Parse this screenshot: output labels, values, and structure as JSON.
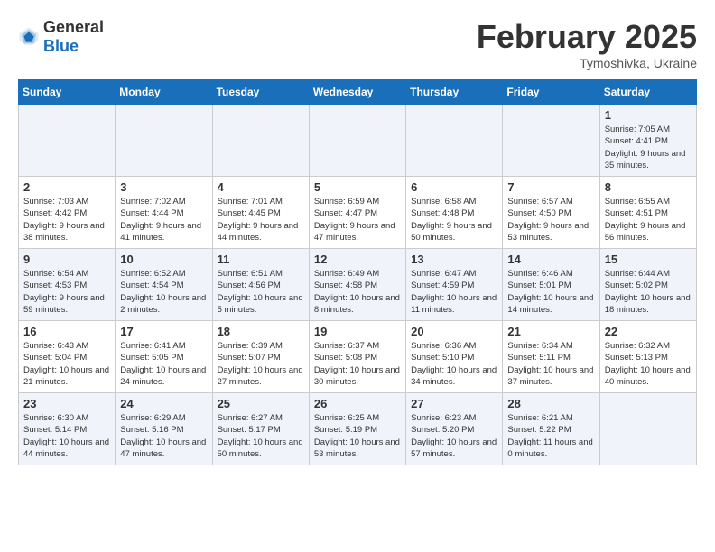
{
  "header": {
    "logo_general": "General",
    "logo_blue": "Blue",
    "title": "February 2025",
    "subtitle": "Tymoshivka, Ukraine"
  },
  "weekdays": [
    "Sunday",
    "Monday",
    "Tuesday",
    "Wednesday",
    "Thursday",
    "Friday",
    "Saturday"
  ],
  "weeks": [
    [
      {
        "day": "",
        "info": ""
      },
      {
        "day": "",
        "info": ""
      },
      {
        "day": "",
        "info": ""
      },
      {
        "day": "",
        "info": ""
      },
      {
        "day": "",
        "info": ""
      },
      {
        "day": "",
        "info": ""
      },
      {
        "day": "1",
        "info": "Sunrise: 7:05 AM\nSunset: 4:41 PM\nDaylight: 9 hours and 35 minutes."
      }
    ],
    [
      {
        "day": "2",
        "info": "Sunrise: 7:03 AM\nSunset: 4:42 PM\nDaylight: 9 hours and 38 minutes."
      },
      {
        "day": "3",
        "info": "Sunrise: 7:02 AM\nSunset: 4:44 PM\nDaylight: 9 hours and 41 minutes."
      },
      {
        "day": "4",
        "info": "Sunrise: 7:01 AM\nSunset: 4:45 PM\nDaylight: 9 hours and 44 minutes."
      },
      {
        "day": "5",
        "info": "Sunrise: 6:59 AM\nSunset: 4:47 PM\nDaylight: 9 hours and 47 minutes."
      },
      {
        "day": "6",
        "info": "Sunrise: 6:58 AM\nSunset: 4:48 PM\nDaylight: 9 hours and 50 minutes."
      },
      {
        "day": "7",
        "info": "Sunrise: 6:57 AM\nSunset: 4:50 PM\nDaylight: 9 hours and 53 minutes."
      },
      {
        "day": "8",
        "info": "Sunrise: 6:55 AM\nSunset: 4:51 PM\nDaylight: 9 hours and 56 minutes."
      }
    ],
    [
      {
        "day": "9",
        "info": "Sunrise: 6:54 AM\nSunset: 4:53 PM\nDaylight: 9 hours and 59 minutes."
      },
      {
        "day": "10",
        "info": "Sunrise: 6:52 AM\nSunset: 4:54 PM\nDaylight: 10 hours and 2 minutes."
      },
      {
        "day": "11",
        "info": "Sunrise: 6:51 AM\nSunset: 4:56 PM\nDaylight: 10 hours and 5 minutes."
      },
      {
        "day": "12",
        "info": "Sunrise: 6:49 AM\nSunset: 4:58 PM\nDaylight: 10 hours and 8 minutes."
      },
      {
        "day": "13",
        "info": "Sunrise: 6:47 AM\nSunset: 4:59 PM\nDaylight: 10 hours and 11 minutes."
      },
      {
        "day": "14",
        "info": "Sunrise: 6:46 AM\nSunset: 5:01 PM\nDaylight: 10 hours and 14 minutes."
      },
      {
        "day": "15",
        "info": "Sunrise: 6:44 AM\nSunset: 5:02 PM\nDaylight: 10 hours and 18 minutes."
      }
    ],
    [
      {
        "day": "16",
        "info": "Sunrise: 6:43 AM\nSunset: 5:04 PM\nDaylight: 10 hours and 21 minutes."
      },
      {
        "day": "17",
        "info": "Sunrise: 6:41 AM\nSunset: 5:05 PM\nDaylight: 10 hours and 24 minutes."
      },
      {
        "day": "18",
        "info": "Sunrise: 6:39 AM\nSunset: 5:07 PM\nDaylight: 10 hours and 27 minutes."
      },
      {
        "day": "19",
        "info": "Sunrise: 6:37 AM\nSunset: 5:08 PM\nDaylight: 10 hours and 30 minutes."
      },
      {
        "day": "20",
        "info": "Sunrise: 6:36 AM\nSunset: 5:10 PM\nDaylight: 10 hours and 34 minutes."
      },
      {
        "day": "21",
        "info": "Sunrise: 6:34 AM\nSunset: 5:11 PM\nDaylight: 10 hours and 37 minutes."
      },
      {
        "day": "22",
        "info": "Sunrise: 6:32 AM\nSunset: 5:13 PM\nDaylight: 10 hours and 40 minutes."
      }
    ],
    [
      {
        "day": "23",
        "info": "Sunrise: 6:30 AM\nSunset: 5:14 PM\nDaylight: 10 hours and 44 minutes."
      },
      {
        "day": "24",
        "info": "Sunrise: 6:29 AM\nSunset: 5:16 PM\nDaylight: 10 hours and 47 minutes."
      },
      {
        "day": "25",
        "info": "Sunrise: 6:27 AM\nSunset: 5:17 PM\nDaylight: 10 hours and 50 minutes."
      },
      {
        "day": "26",
        "info": "Sunrise: 6:25 AM\nSunset: 5:19 PM\nDaylight: 10 hours and 53 minutes."
      },
      {
        "day": "27",
        "info": "Sunrise: 6:23 AM\nSunset: 5:20 PM\nDaylight: 10 hours and 57 minutes."
      },
      {
        "day": "28",
        "info": "Sunrise: 6:21 AM\nSunset: 5:22 PM\nDaylight: 11 hours and 0 minutes."
      },
      {
        "day": "",
        "info": ""
      }
    ]
  ]
}
